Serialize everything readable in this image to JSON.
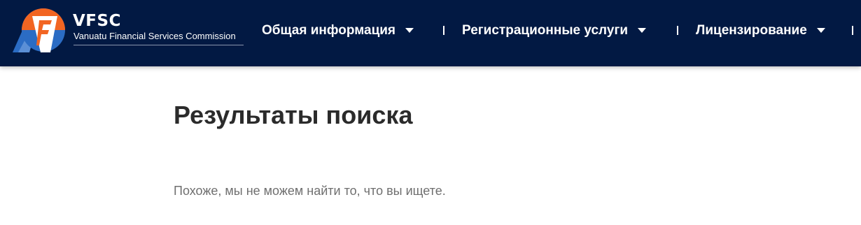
{
  "header": {
    "brand": {
      "title": "VFSC",
      "subtitle": "Vanuatu Financial Services Commission",
      "logo_icon": "vfsc-logo-icon",
      "colors": {
        "navy": "#021943",
        "orange": "#f26522",
        "blue": "#2b6cc4"
      }
    },
    "nav": [
      {
        "label": "Общая информация",
        "icon": "chevron-down-icon"
      },
      {
        "label": "Регистрационные услуги",
        "icon": "chevron-down-icon"
      },
      {
        "label": "Лицензирование",
        "icon": "chevron-down-icon"
      }
    ]
  },
  "main": {
    "title": "Результаты поиска",
    "empty_message": "Похоже, мы не можем найти то, что вы ищете."
  }
}
